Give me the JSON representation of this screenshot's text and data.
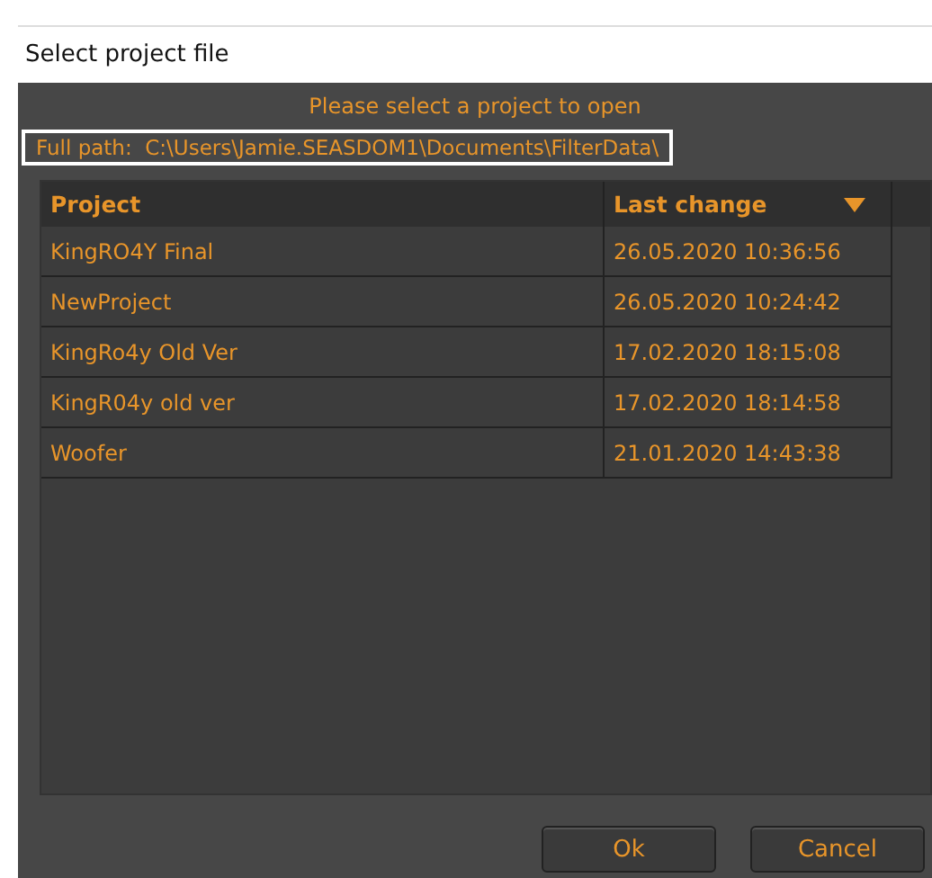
{
  "window": {
    "title": "Select project file"
  },
  "prompt": "Please select a project to open",
  "path": {
    "label": "Full path:",
    "value": "C:\\Users\\Jamie.SEASDOM1\\Documents\\FilterData\\"
  },
  "table": {
    "columns": [
      {
        "label": "Project",
        "sorted": false
      },
      {
        "label": "Last change",
        "sorted": true
      }
    ],
    "rows": [
      {
        "project": "KingRO4Y Final",
        "last_change": "26.05.2020 10:36:56"
      },
      {
        "project": "NewProject",
        "last_change": "26.05.2020 10:24:42"
      },
      {
        "project": "KingRo4y Old Ver",
        "last_change": "17.02.2020 18:15:08"
      },
      {
        "project": "KingR04y old ver",
        "last_change": "17.02.2020 18:14:58"
      },
      {
        "project": "Woofer",
        "last_change": "21.01.2020 14:43:38"
      }
    ]
  },
  "buttons": [
    "Ok",
    "Cancel"
  ]
}
